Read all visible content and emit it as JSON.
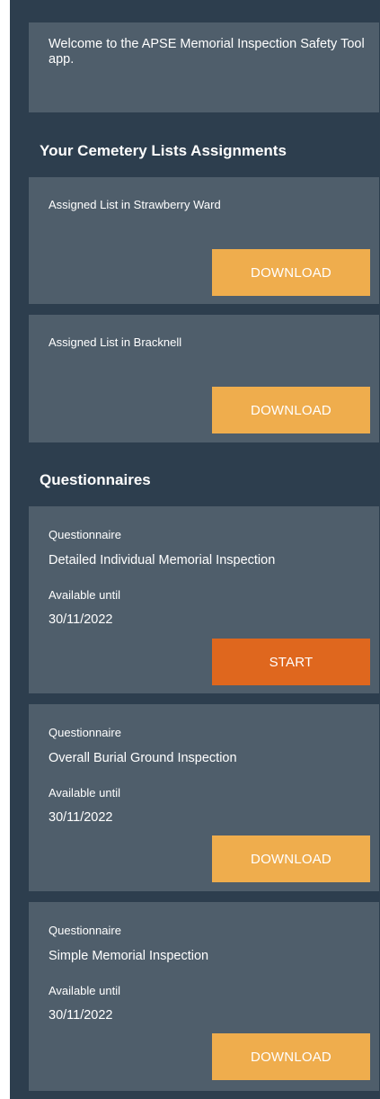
{
  "colors": {
    "page_background": "#2d3e4e",
    "card_background": "#4f5e6b",
    "download_button": "#efad4d",
    "start_button": "#df671e",
    "text": "#ffffff"
  },
  "welcome": {
    "message": "Welcome to the APSE Memorial Inspection Safety Tool app."
  },
  "assignments": {
    "heading": "Your Cemetery Lists Assignments",
    "items": [
      {
        "label": "Assigned List in Strawberry Ward",
        "button_label": "DOWNLOAD"
      },
      {
        "label": "Assigned List in Bracknell",
        "button_label": "DOWNLOAD"
      }
    ]
  },
  "questionnaires": {
    "heading": "Questionnaires",
    "items": [
      {
        "type_label": "Questionnaire",
        "title": "Detailed Individual Memorial Inspection",
        "availability_label": "Available until",
        "date": "30/11/2022",
        "button_label": "START"
      },
      {
        "type_label": "Questionnaire",
        "title": "Overall Burial Ground Inspection",
        "availability_label": "Available until",
        "date": "30/11/2022",
        "button_label": "DOWNLOAD"
      },
      {
        "type_label": "Questionnaire",
        "title": "Simple Memorial Inspection",
        "availability_label": "Available until",
        "date": "30/11/2022",
        "button_label": "DOWNLOAD"
      }
    ]
  }
}
